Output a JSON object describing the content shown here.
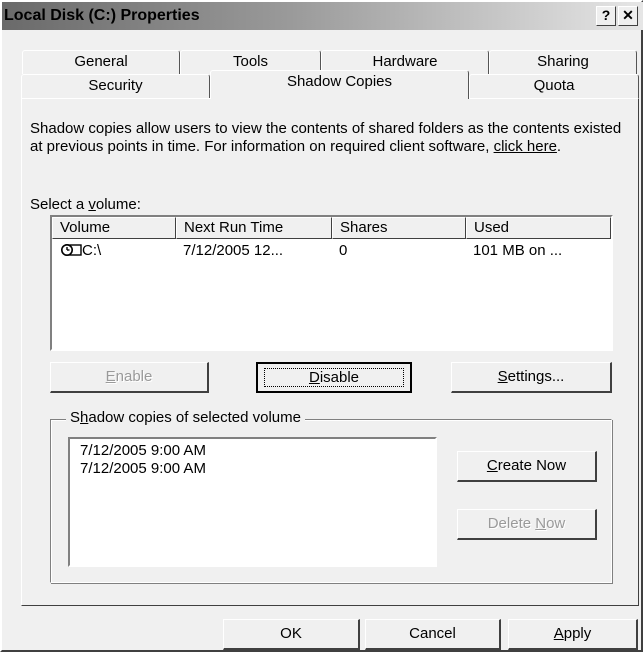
{
  "window": {
    "title": "Local Disk (C:) Properties",
    "help_button": "?",
    "close_button": "✕"
  },
  "tabs": {
    "row1": [
      "General",
      "Tools",
      "Hardware",
      "Sharing"
    ],
    "row2": [
      "Security",
      "Shadow Copies",
      "Quota"
    ],
    "active": "Shadow Copies"
  },
  "description": {
    "text": "Shadow copies allow users to view the contents of shared folders as the contents existed at previous points in time. For information on required client software, ",
    "link": "click here",
    "suffix": "."
  },
  "volume_section": {
    "label_pre": "Select a ",
    "label_underline": "v",
    "label_post": "olume:",
    "columns": [
      "Volume",
      "Next Run Time",
      "Shares",
      "Used"
    ],
    "rows": [
      {
        "volume": "C:\\",
        "next_run_time": "7/12/2005 12...",
        "shares": "0",
        "used": "101 MB on ..."
      }
    ]
  },
  "buttons": {
    "enable": {
      "u": "E",
      "rest": "nable",
      "disabled": true
    },
    "disable": {
      "u": "D",
      "rest": "isable"
    },
    "settings": {
      "u": "S",
      "rest": "ettings..."
    }
  },
  "shadow_copies": {
    "legend_pre": "S",
    "legend_underline": "h",
    "legend_post": "adow copies of selected volume",
    "items": [
      "7/12/2005 9:00 AM",
      "7/12/2005 9:00 AM"
    ],
    "create_now": {
      "u": "C",
      "rest": "reate Now"
    },
    "delete_now": {
      "pre": "Delete ",
      "u": "N",
      "rest": "ow",
      "disabled": true
    }
  },
  "footer": {
    "ok": "OK",
    "cancel": "Cancel",
    "apply_u": "A",
    "apply_rest": "pply"
  }
}
